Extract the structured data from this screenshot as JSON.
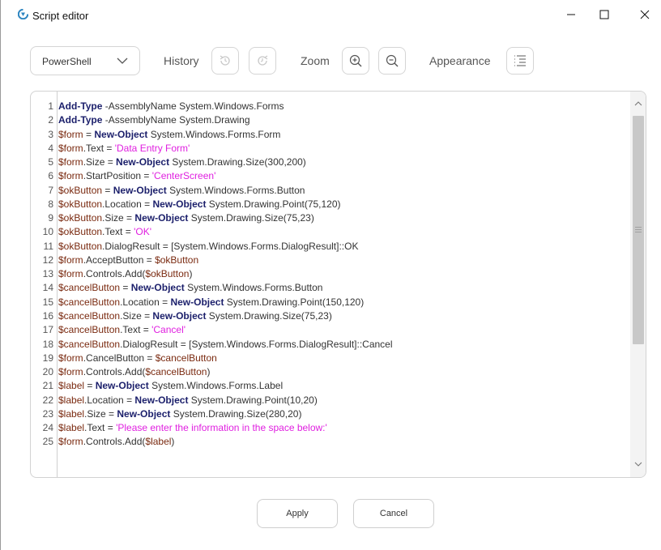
{
  "window": {
    "title": "Script editor",
    "icon": "script-editor-logo",
    "controls": [
      "minimize-icon",
      "maximize-icon",
      "close-icon"
    ]
  },
  "toolbar": {
    "language": {
      "selected": "PowerShell",
      "icon": "chevron-down-icon"
    },
    "history_label": "History",
    "history_buttons": [
      {
        "name": "undo",
        "icon": "undo-icon",
        "enabled": false
      },
      {
        "name": "redo",
        "icon": "redo-icon",
        "enabled": false
      }
    ],
    "zoom_label": "Zoom",
    "zoom_buttons": [
      {
        "name": "zoom-in",
        "icon": "zoom-in-icon"
      },
      {
        "name": "zoom-out",
        "icon": "zoom-out-icon"
      }
    ],
    "appearance_label": "Appearance",
    "appearance_icon": "line-settings-icon"
  },
  "editor": {
    "lines": [
      [
        [
          "kw",
          "Add-Type"
        ],
        [
          "t",
          " -AssemblyName System.Windows.Forms"
        ]
      ],
      [
        [
          "kw",
          "Add-Type"
        ],
        [
          "t",
          " -AssemblyName System.Drawing"
        ]
      ],
      [
        [
          "var",
          "$form"
        ],
        [
          "t",
          " = "
        ],
        [
          "kw",
          "New-Object"
        ],
        [
          "t",
          " System.Windows.Forms.Form"
        ]
      ],
      [
        [
          "var",
          "$form"
        ],
        [
          "t",
          ".Text = "
        ],
        [
          "str",
          "'Data Entry Form'"
        ]
      ],
      [
        [
          "var",
          "$form"
        ],
        [
          "t",
          ".Size = "
        ],
        [
          "kw",
          "New-Object"
        ],
        [
          "t",
          " System.Drawing.Size(300,200)"
        ]
      ],
      [
        [
          "var",
          "$form"
        ],
        [
          "t",
          ".StartPosition = "
        ],
        [
          "str",
          "'CenterScreen'"
        ]
      ],
      [
        [
          "var",
          "$okButton"
        ],
        [
          "t",
          " = "
        ],
        [
          "kw",
          "New-Object"
        ],
        [
          "t",
          " System.Windows.Forms.Button"
        ]
      ],
      [
        [
          "var",
          "$okButton"
        ],
        [
          "t",
          ".Location = "
        ],
        [
          "kw",
          "New-Object"
        ],
        [
          "t",
          " System.Drawing.Point(75,120)"
        ]
      ],
      [
        [
          "var",
          "$okButton"
        ],
        [
          "t",
          ".Size = "
        ],
        [
          "kw",
          "New-Object"
        ],
        [
          "t",
          " System.Drawing.Size(75,23)"
        ]
      ],
      [
        [
          "var",
          "$okButton"
        ],
        [
          "t",
          ".Text = "
        ],
        [
          "str",
          "'OK'"
        ]
      ],
      [
        [
          "var",
          "$okButton"
        ],
        [
          "t",
          ".DialogResult = [System.Windows.Forms.DialogResult]::OK"
        ]
      ],
      [
        [
          "var",
          "$form"
        ],
        [
          "t",
          ".AcceptButton = "
        ],
        [
          "var",
          "$okButton"
        ]
      ],
      [
        [
          "var",
          "$form"
        ],
        [
          "t",
          ".Controls.Add("
        ],
        [
          "var",
          "$okButton"
        ],
        [
          "t",
          ")"
        ]
      ],
      [
        [
          "var",
          "$cancelButton"
        ],
        [
          "t",
          " = "
        ],
        [
          "kw",
          "New-Object"
        ],
        [
          "t",
          " System.Windows.Forms.Button"
        ]
      ],
      [
        [
          "var",
          "$cancelButton"
        ],
        [
          "t",
          ".Location = "
        ],
        [
          "kw",
          "New-Object"
        ],
        [
          "t",
          " System.Drawing.Point(150,120)"
        ]
      ],
      [
        [
          "var",
          "$cancelButton"
        ],
        [
          "t",
          ".Size = "
        ],
        [
          "kw",
          "New-Object"
        ],
        [
          "t",
          " System.Drawing.Size(75,23)"
        ]
      ],
      [
        [
          "var",
          "$cancelButton"
        ],
        [
          "t",
          ".Text = "
        ],
        [
          "str",
          "'Cancel'"
        ]
      ],
      [
        [
          "var",
          "$cancelButton"
        ],
        [
          "t",
          ".DialogResult = [System.Windows.Forms.DialogResult]::Cancel"
        ]
      ],
      [
        [
          "var",
          "$form"
        ],
        [
          "t",
          ".CancelButton = "
        ],
        [
          "var",
          "$cancelButton"
        ]
      ],
      [
        [
          "var",
          "$form"
        ],
        [
          "t",
          ".Controls.Add("
        ],
        [
          "var",
          "$cancelButton"
        ],
        [
          "t",
          ")"
        ]
      ],
      [
        [
          "var",
          "$label"
        ],
        [
          "t",
          " = "
        ],
        [
          "kw",
          "New-Object"
        ],
        [
          "t",
          " System.Windows.Forms.Label"
        ]
      ],
      [
        [
          "var",
          "$label"
        ],
        [
          "t",
          ".Location = "
        ],
        [
          "kw",
          "New-Object"
        ],
        [
          "t",
          " System.Drawing.Point(10,20)"
        ]
      ],
      [
        [
          "var",
          "$label"
        ],
        [
          "t",
          ".Size = "
        ],
        [
          "kw",
          "New-Object"
        ],
        [
          "t",
          " System.Drawing.Size(280,20)"
        ]
      ],
      [
        [
          "var",
          "$label"
        ],
        [
          "t",
          ".Text = "
        ],
        [
          "str",
          "'Please enter the information in the space below:'"
        ]
      ],
      [
        [
          "var",
          "$form"
        ],
        [
          "t",
          ".Controls.Add("
        ],
        [
          "var",
          "$label"
        ],
        [
          "t",
          ")"
        ]
      ]
    ],
    "colors": {
      "keyword": "#1b1f6b",
      "variable": "#7a2a10",
      "string": "#e020e0",
      "text": "#333333"
    },
    "scrollbar": {
      "icons": [
        "scroll-up-icon",
        "scroll-down-icon"
      ]
    }
  },
  "footer": {
    "apply_label": "Apply",
    "cancel_label": "Cancel"
  }
}
